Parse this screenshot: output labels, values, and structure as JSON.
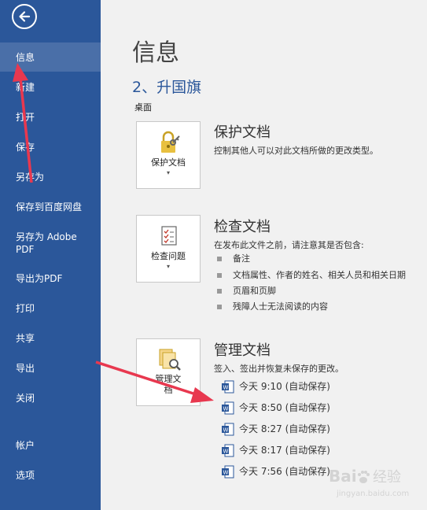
{
  "sidebar": {
    "items": [
      {
        "label": "信息"
      },
      {
        "label": "新建"
      },
      {
        "label": "打开"
      },
      {
        "label": "保存"
      },
      {
        "label": "另存为"
      },
      {
        "label": "保存到百度网盘"
      },
      {
        "label": "另存为 Adobe PDF"
      },
      {
        "label": "导出为PDF"
      },
      {
        "label": "打印"
      },
      {
        "label": "共享"
      },
      {
        "label": "导出"
      },
      {
        "label": "关闭"
      },
      {
        "label": "帐户"
      },
      {
        "label": "选项"
      }
    ]
  },
  "main": {
    "title": "信息",
    "step_title": "2、升国旗",
    "location": "桌面",
    "protect": {
      "button_label": "保护文档",
      "title": "保护文档",
      "desc": "控制其他人可以对此文档所做的更改类型。"
    },
    "inspect": {
      "button_label": "检查问题",
      "title": "检查文档",
      "desc": "在发布此文件之前，请注意其是否包含:",
      "bullets": [
        "备注",
        "文档属性、作者的姓名、相关人员和相关日期",
        "页眉和页脚",
        "残障人士无法阅读的内容"
      ]
    },
    "manage": {
      "button_label_1": "管理文",
      "button_label_2": "档",
      "title": "管理文档",
      "desc": "签入、签出并恢复未保存的更改。",
      "versions": [
        {
          "label": "今天 9:10 (自动保存)"
        },
        {
          "label": "今天 8:50 (自动保存)"
        },
        {
          "label": "今天 8:27 (自动保存)"
        },
        {
          "label": "今天 8:17 (自动保存)"
        },
        {
          "label": "今天 7:56 (自动保存)"
        }
      ]
    }
  },
  "watermark": {
    "text": "Bai 经验",
    "sub": "jingyan.baidu.com"
  },
  "colors": {
    "sidebar": "#2b579a",
    "active": "#4a6fa8",
    "annotation": "#e8384f",
    "accent_text": "#2b579a"
  }
}
